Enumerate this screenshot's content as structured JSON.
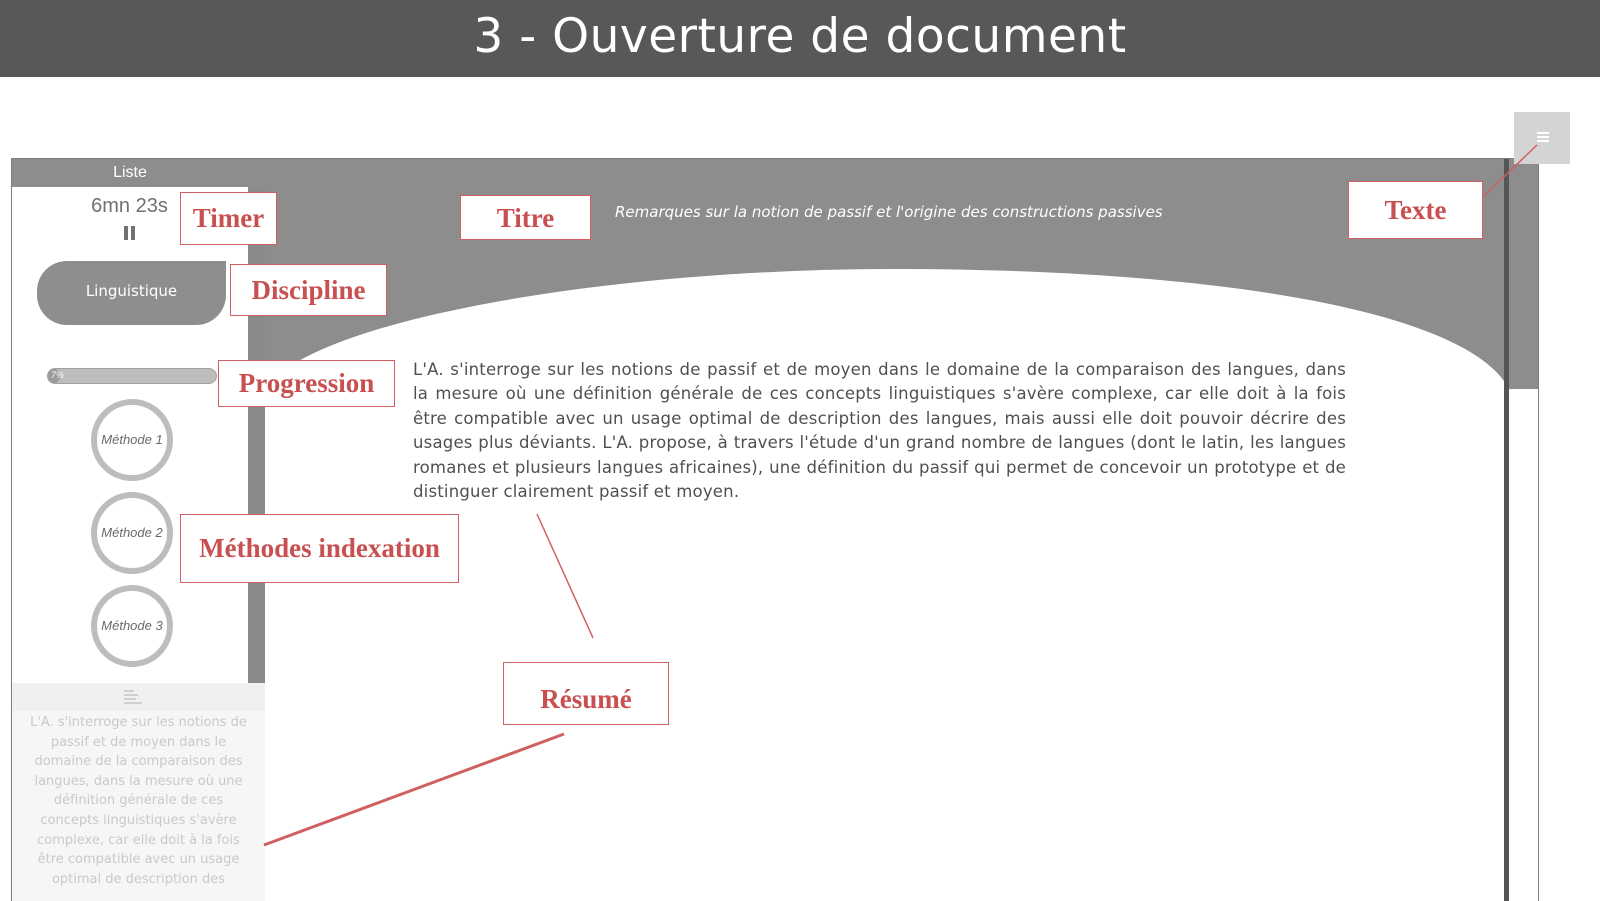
{
  "banner": {
    "title": "3 - Ouverture de document"
  },
  "header": {
    "list_tab": "Liste",
    "document_title": "Remarques sur la notion de passif et l'origine des constructions passives"
  },
  "sidebar": {
    "timer": "6mn 23s",
    "discipline": "Linguistique",
    "progress": {
      "label": "7%",
      "value_percent": 7
    },
    "methods": [
      "Méthode 1",
      "Méthode 2",
      "Méthode 3"
    ],
    "summary": "L'A. s'interroge sur les notions de passif et de moyen dans le domaine de la comparaison des langues, dans la mesure où une définition générale de ces concepts linguistiques s'avère complexe, car elle doit à la fois être compatible avec un usage optimal de description des"
  },
  "main": {
    "abstract": "L'A. s'interroge sur les notions de passif et de moyen dans le domaine de la comparaison des langues, dans la mesure où une définition générale de ces concepts linguistiques s'avère complexe, car elle doit à la fois être compatible avec un usage optimal de description des langues, mais aussi elle doit pouvoir décrire des usages plus déviants. L'A. propose, à travers l'étude d'un grand nombre de langues (dont le latin, les langues romanes et plusieurs langues africaines), une définition du passif qui permet de concevoir un prototype et de distinguer clairement passif et moyen."
  },
  "annotations": {
    "timer": "Timer",
    "titre": "Titre",
    "texte": "Texte",
    "discipline": "Discipline",
    "progression": "Progression",
    "methodes": "Méthodes indexation",
    "resume": "Résumé"
  },
  "colors": {
    "banner_bg": "#585858",
    "header_gray": "#8d8d8d",
    "callout_red": "#c85050"
  },
  "icons": {
    "pause": "pause-icon",
    "summary": "text-lines-icon",
    "side_button": "text-lines-icon"
  }
}
